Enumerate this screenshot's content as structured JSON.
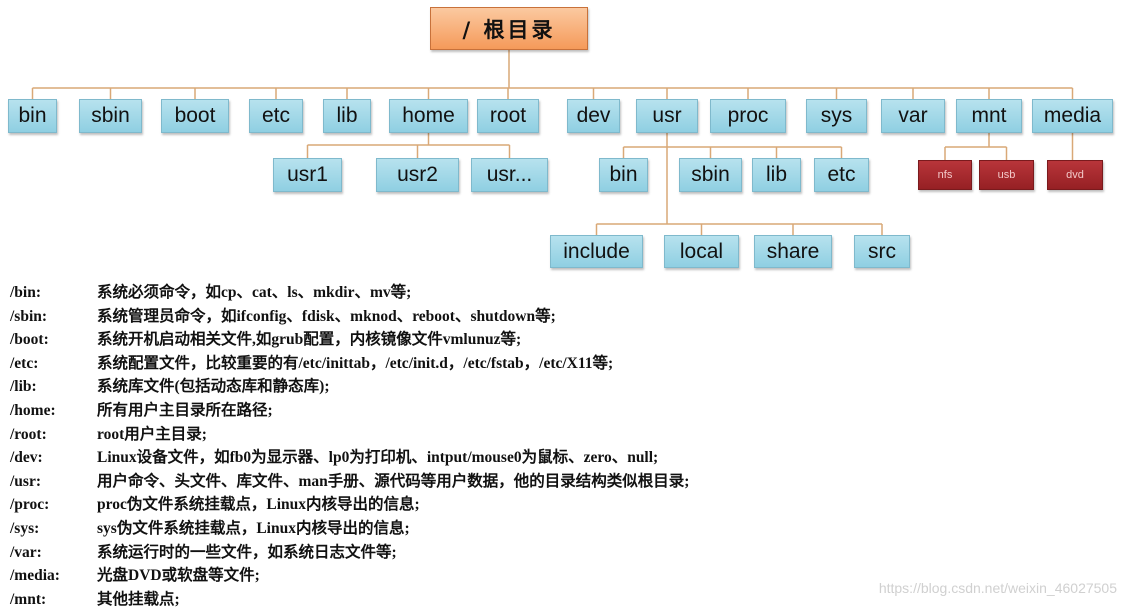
{
  "colors": {
    "node": "#a5d9e8",
    "root": "#f8ae78",
    "leaf_red": "#a8292d",
    "line": "#d9a877"
  },
  "tree": {
    "root": "/ 根目录",
    "top": [
      "bin",
      "sbin",
      "boot",
      "etc",
      "lib",
      "home",
      "root",
      "dev",
      "usr",
      "proc",
      "sys",
      "var",
      "mnt",
      "media"
    ],
    "home_children": [
      "usr1",
      "usr2",
      "usr..."
    ],
    "usr_children": [
      "bin",
      "sbin",
      "lib",
      "etc"
    ],
    "usr_children2": [
      "include",
      "local",
      "share",
      "src"
    ],
    "mnt_children": [
      "nfs",
      "usb"
    ],
    "media_children": [
      "dvd"
    ]
  },
  "descriptions": [
    {
      "dir": "/bin:",
      "text": "系统必须命令，如cp、cat、ls、mkdir、mv等;"
    },
    {
      "dir": "/sbin:",
      "text": "系统管理员命令，如ifconfig、fdisk、mknod、reboot、shutdown等;"
    },
    {
      "dir": "/boot:",
      "text": "系统开机启动相关文件,如grub配置，内核镜像文件vmlunuz等;"
    },
    {
      "dir": "/etc:",
      "text": "系统配置文件，比较重要的有/etc/inittab，/etc/init.d，/etc/fstab，/etc/X11等;"
    },
    {
      "dir": "/lib:",
      "text": "系统库文件(包括动态库和静态库);"
    },
    {
      "dir": "/home:",
      "text": "所有用户主目录所在路径;"
    },
    {
      "dir": "/root:",
      "text": "root用户主目录;"
    },
    {
      "dir": "/dev:",
      "text": "Linux设备文件，如fb0为显示器、lp0为打印机、intput/mouse0为鼠标、zero、null;"
    },
    {
      "dir": "/usr:",
      "text": "用户命令、头文件、库文件、man手册、源代码等用户数据，他的目录结构类似根目录;"
    },
    {
      "dir": "/proc:",
      "text": "proc伪文件系统挂载点，Linux内核导出的信息;"
    },
    {
      "dir": "/sys:",
      "text": "sys伪文件系统挂载点，Linux内核导出的信息;"
    },
    {
      "dir": "/var:",
      "text": "系统运行时的一些文件，如系统日志文件等;"
    },
    {
      "dir": "/media:",
      "text": "光盘DVD或软盘等文件;"
    },
    {
      "dir": "/mnt:",
      "text": "其他挂载点;"
    }
  ],
  "watermark": "https://blog.csdn.net/weixin_46027505"
}
